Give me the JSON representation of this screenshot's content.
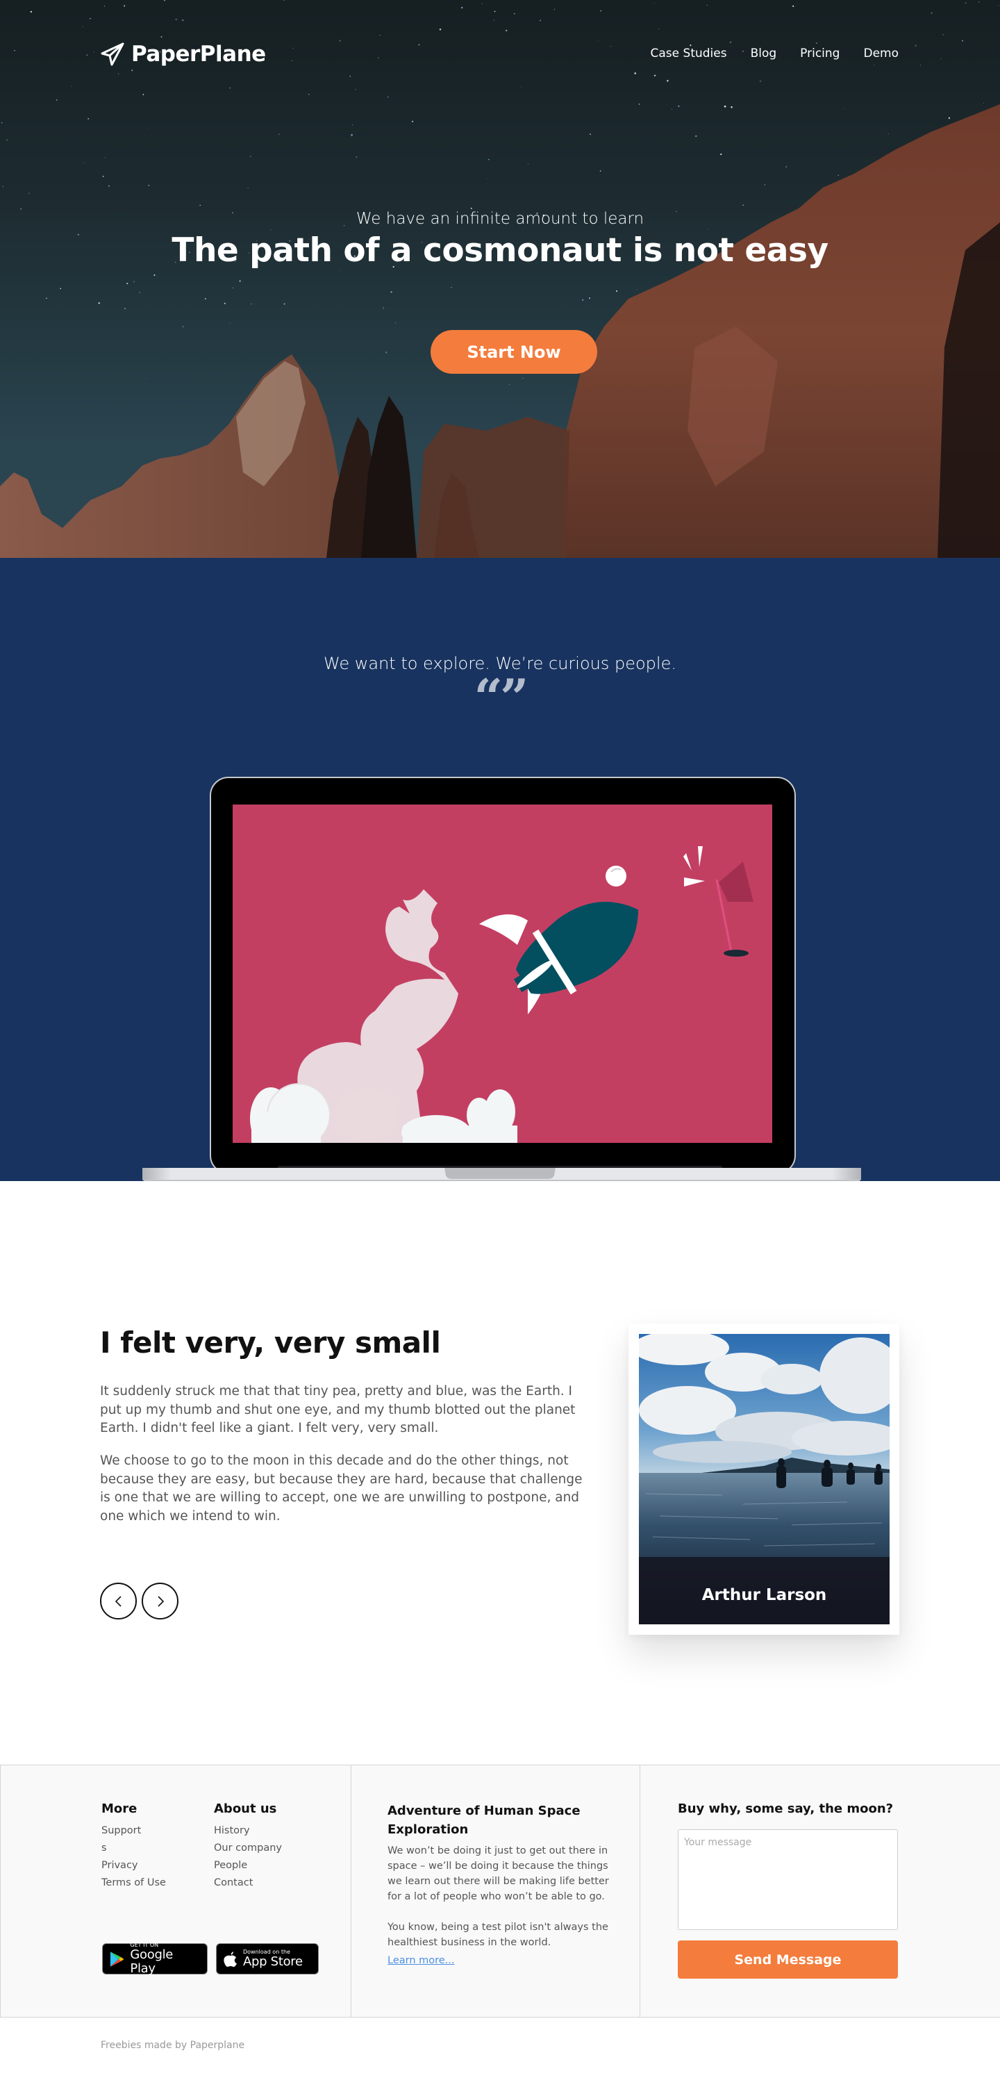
{
  "brand": {
    "name": "PaperPlane",
    "icon": "paper-plane-icon"
  },
  "nav": {
    "links": [
      {
        "label": "Case Studies"
      },
      {
        "label": "Blog"
      },
      {
        "label": "Pricing"
      },
      {
        "label": "Demo"
      }
    ]
  },
  "hero": {
    "subtitle": "We have an infinite amount to learn",
    "title": "The path of a cosmonaut is not easy",
    "cta_label": "Start Now"
  },
  "explore": {
    "text": "We want to explore. We’re curious people.",
    "quote_glyph": "“”",
    "illustration": "laptop-rocket-illustration"
  },
  "story": {
    "title": "I felt very, very small",
    "paragraphs": [
      "It suddenly struck me that that tiny pea, pretty and blue, was the Earth. I put up my thumb and shut one eye, and my thumb blotted out the planet Earth. I didn't feel like a giant. I felt very, very small.",
      "We choose to go to the moon in this decade and do the other things, not because they are easy, but because they are hard, because that challenge is one that we are willing to accept, one we are unwilling to postpone, and one which we intend to win."
    ],
    "prev_icon": "chevron-left-icon",
    "next_icon": "chevron-right-icon",
    "card": {
      "name": "Arthur Larson",
      "photo": "people-wading-in-sea-photo"
    }
  },
  "footer": {
    "more": {
      "heading": "More",
      "items": [
        "Support",
        "s",
        "Privacy",
        "Terms of Use"
      ]
    },
    "about": {
      "heading": "About us",
      "items": [
        "History",
        "Our company",
        "People",
        "Contact"
      ]
    },
    "badges": {
      "google": {
        "small": "GET IT ON",
        "big": "Google Play"
      },
      "apple": {
        "small": "Download on the",
        "big": "App Store"
      }
    },
    "adventure": {
      "heading": "Adventure of Human Space Exploration",
      "text1": "We won’t be doing it just to get out there in space – we’ll be doing it because the things we learn out there will be making life better for a lot of people who won’t be able to go.",
      "text2": "You know, being a test pilot isn't always the healthiest business in the world.",
      "link": "Learn more..."
    },
    "contact": {
      "heading": "Buy why, some say, the moon?",
      "placeholder": "Your message",
      "value": "",
      "button": "Send Message"
    }
  },
  "credit": "Freebies made by Paperplane",
  "colors": {
    "accent": "#f47c3c",
    "navy": "#18335f",
    "screen": "#c33f62",
    "rocket": "#034f60",
    "link": "#4a90e2"
  }
}
